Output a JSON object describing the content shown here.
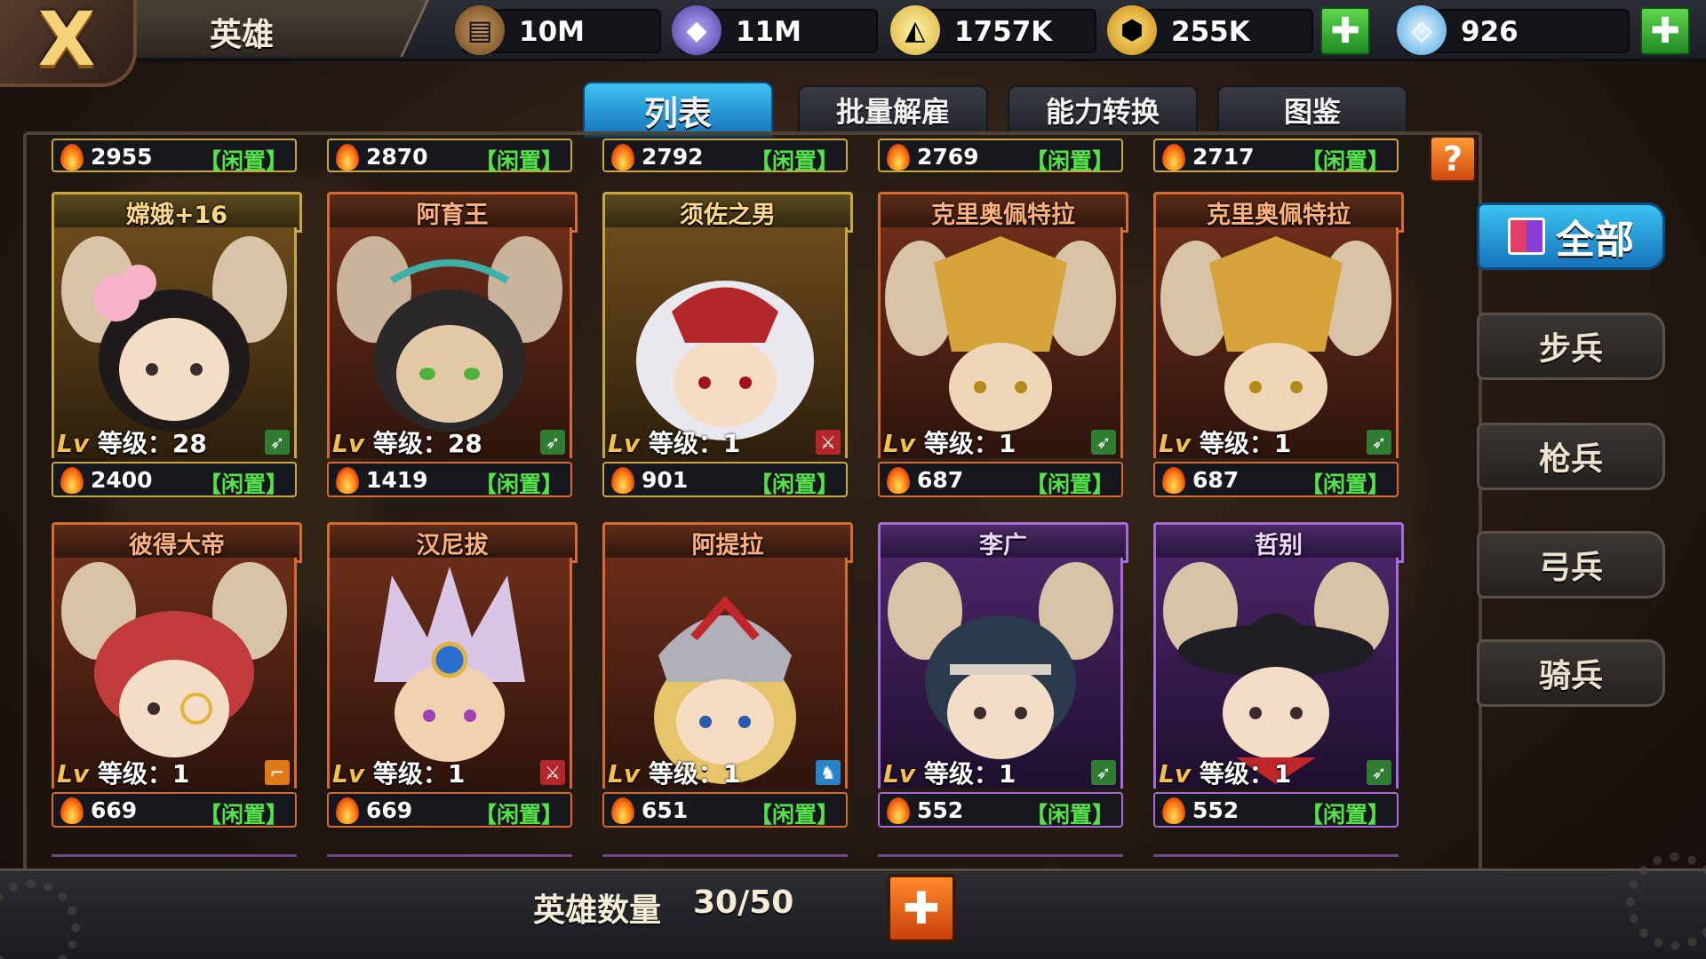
{
  "header": {
    "close_glyph": "X",
    "title": "英雄",
    "resources": [
      {
        "icon": "wood-icon",
        "value": "10M"
      },
      {
        "icon": "ore-icon",
        "value": "11M"
      },
      {
        "icon": "cheese-icon",
        "value": "1757K"
      },
      {
        "icon": "gold-icon",
        "value": "255K"
      },
      {
        "icon": "diamond-icon",
        "value": "926"
      }
    ]
  },
  "tabs": [
    {
      "label": "列表",
      "active": true
    },
    {
      "label": "批量解雇",
      "active": false
    },
    {
      "label": "能力转换",
      "active": false
    },
    {
      "label": "图鉴",
      "active": false
    }
  ],
  "help_glyph": "?",
  "top_row": [
    {
      "power": "2955",
      "status": "【闲置】"
    },
    {
      "power": "2870",
      "status": "【闲置】"
    },
    {
      "power": "2792",
      "status": "【闲置】"
    },
    {
      "power": "2769",
      "status": "【闲置】"
    },
    {
      "power": "2717",
      "status": "【闲置】"
    }
  ],
  "heroes": [
    {
      "name": "嫦娥+16",
      "lv_tag": "Lv",
      "level_label": "等级：28",
      "class_icon": "archer-icon",
      "power": "2400",
      "status": "【闲置】",
      "rarity": "gold"
    },
    {
      "name": "阿育王",
      "lv_tag": "Lv",
      "level_label": "等级：28",
      "class_icon": "archer-icon",
      "power": "1419",
      "status": "【闲置】",
      "rarity": "orange"
    },
    {
      "name": "须佐之男",
      "lv_tag": "Lv",
      "level_label": "等级：1",
      "class_icon": "sword-icon",
      "power": "901",
      "status": "【闲置】",
      "rarity": "gold"
    },
    {
      "name": "克里奥佩特拉",
      "lv_tag": "Lv",
      "level_label": "等级：1",
      "class_icon": "archer-icon",
      "power": "687",
      "status": "【闲置】",
      "rarity": "orange"
    },
    {
      "name": "克里奥佩特拉",
      "lv_tag": "Lv",
      "level_label": "等级：1",
      "class_icon": "archer-icon",
      "power": "687",
      "status": "【闲置】",
      "rarity": "orange"
    },
    {
      "name": "彼得大帝",
      "lv_tag": "Lv",
      "level_label": "等级：1",
      "class_icon": "gun-icon",
      "power": "669",
      "status": "【闲置】",
      "rarity": "orange"
    },
    {
      "name": "汉尼拔",
      "lv_tag": "Lv",
      "level_label": "等级：1",
      "class_icon": "sword-icon",
      "power": "669",
      "status": "【闲置】",
      "rarity": "orange"
    },
    {
      "name": "阿提拉",
      "lv_tag": "Lv",
      "level_label": "等级：1",
      "class_icon": "cavalry-icon",
      "power": "651",
      "status": "【闲置】",
      "rarity": "orange"
    },
    {
      "name": "李广",
      "lv_tag": "Lv",
      "level_label": "等级：1",
      "class_icon": "archer-icon",
      "power": "552",
      "status": "【闲置】",
      "rarity": "purple"
    },
    {
      "name": "哲别",
      "lv_tag": "Lv",
      "level_label": "等级：1",
      "class_icon": "archer-icon",
      "power": "552",
      "status": "【闲置】",
      "rarity": "purple"
    }
  ],
  "filters": [
    {
      "label": "全部",
      "active": true
    },
    {
      "label": "步兵",
      "active": false
    },
    {
      "label": "枪兵",
      "active": false
    },
    {
      "label": "弓兵",
      "active": false
    },
    {
      "label": "骑兵",
      "active": false
    }
  ],
  "footer": {
    "count_label": "英雄数量",
    "count_value": "30/50",
    "expand_glyph": "✚"
  },
  "colors": {
    "gold_rarity": "#c9a640",
    "orange_rarity": "#d56a32",
    "purple_rarity": "#a86ad9",
    "idle_status": "#54e24a",
    "active_tab": "#2a9ad8"
  }
}
